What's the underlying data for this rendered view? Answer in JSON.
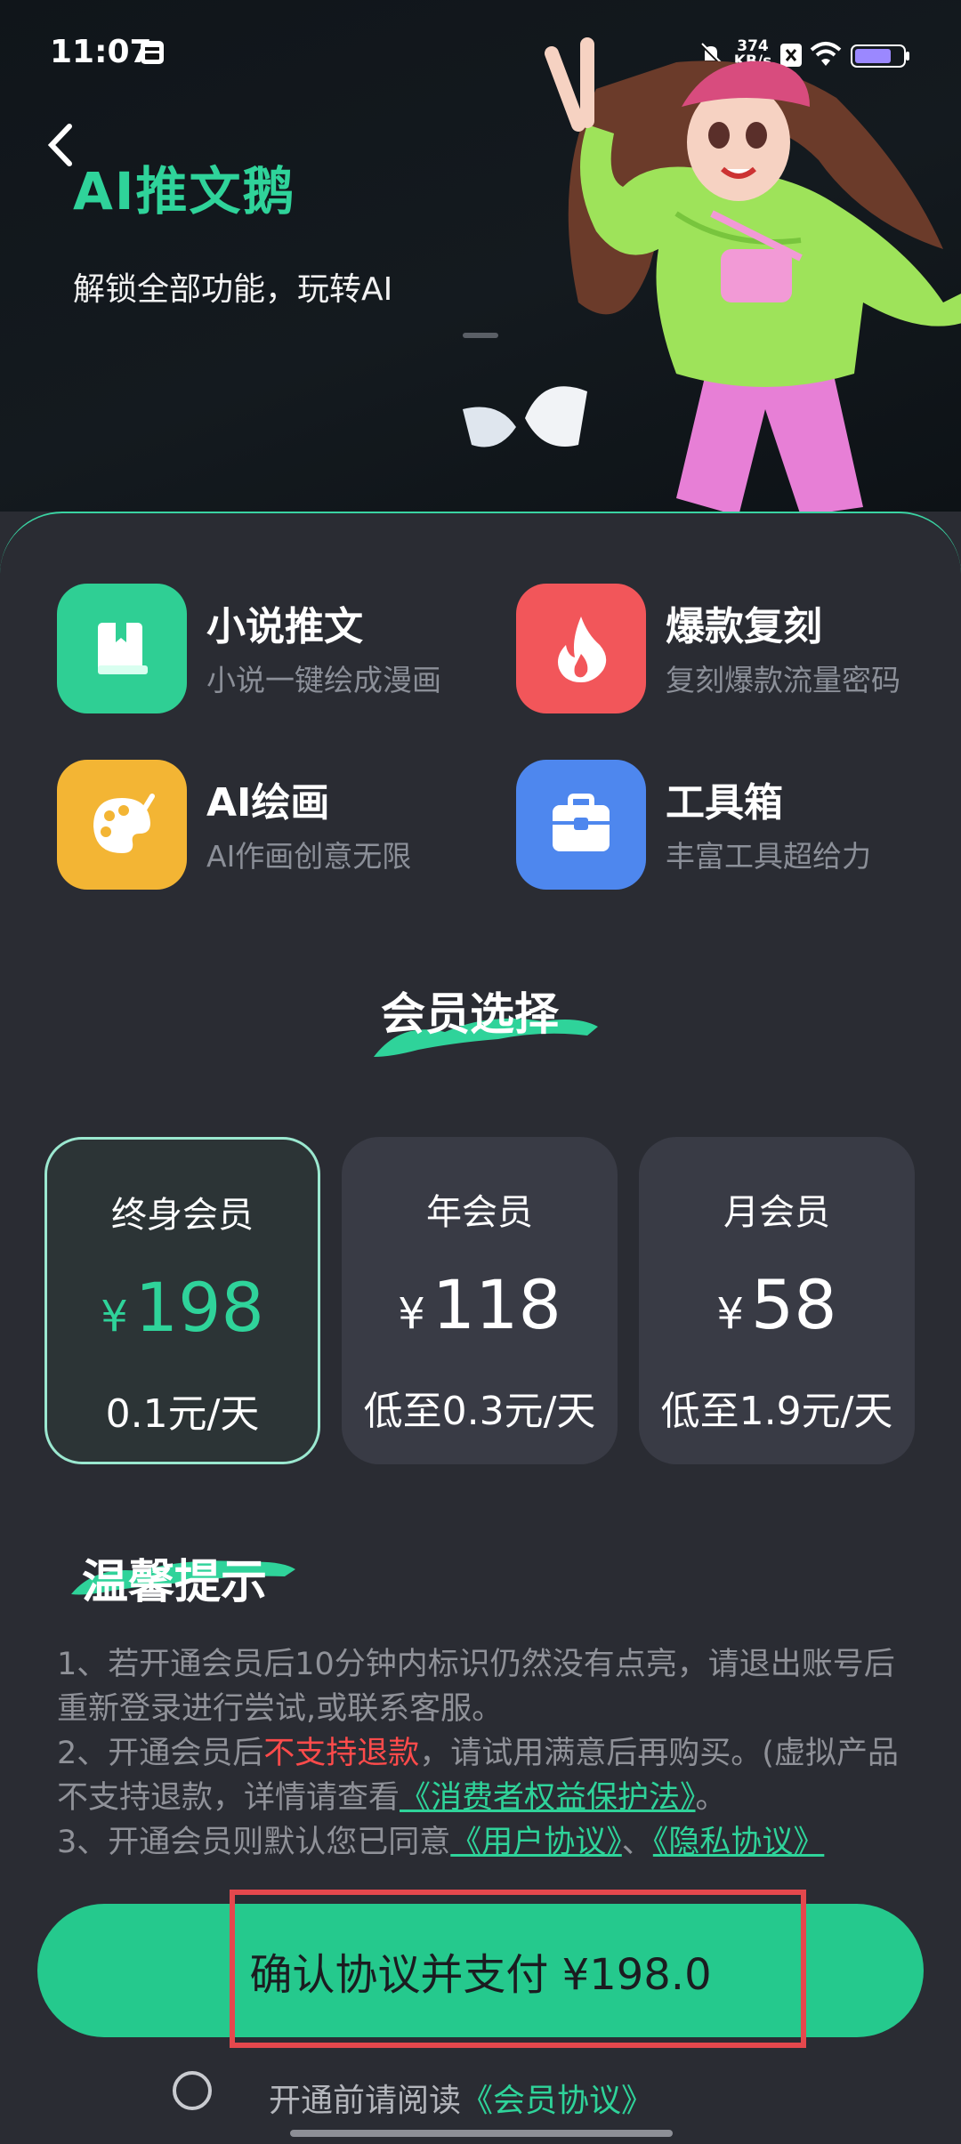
{
  "status_bar": {
    "time": "11:07",
    "net_speed_value": "374",
    "net_speed_unit": "KB/s"
  },
  "hero": {
    "brand": "AI推文鹅",
    "slogan": "解锁全部功能，玩转AI"
  },
  "features": [
    {
      "title": "小说推文",
      "subtitle": "小说一键绘成漫画",
      "icon": "book-icon",
      "color": "#2fcf94"
    },
    {
      "title": "爆款复刻",
      "subtitle": "复刻爆款流量密码",
      "icon": "flame-icon",
      "color": "#f2565a"
    },
    {
      "title": "AI绘画",
      "subtitle": "AI作画创意无限",
      "icon": "palette-icon",
      "color": "#f3b534"
    },
    {
      "title": "工具箱",
      "subtitle": "丰富工具超给力",
      "icon": "toolbox-icon",
      "color": "#4e87ee"
    }
  ],
  "membership": {
    "title": "会员选择",
    "plans": [
      {
        "name": "终身会员",
        "currency": "¥",
        "price": "198",
        "daily": "0.1元/天",
        "selected": true
      },
      {
        "name": "年会员",
        "currency": "¥",
        "price": "118",
        "daily": "低至0.3元/天",
        "selected": false
      },
      {
        "name": "月会员",
        "currency": "¥",
        "price": "58",
        "daily": "低至1.9元/天",
        "selected": false
      }
    ]
  },
  "tips": {
    "title": "温馨提示",
    "line1": "1、若开通会员后10分钟内标识仍然没有点亮，请退出账号后重新登录进行尝试,或联系客服。",
    "line2_a": "2、开通会员后",
    "line2_red": "不支持退款",
    "line2_b": "，请试用满意后再购买。(虚拟产品不支持退款，详情请查看",
    "line2_link": "《消费者权益保护法》",
    "line2_c": "。",
    "line3_a": "3、开通会员则默认您已同意",
    "line3_link1": "《用户协议》",
    "line3_sep": "、",
    "line3_link2": "《隐私协议》"
  },
  "pay_button": "确认协议并支付 ¥198.0",
  "agreement": {
    "text": "开通前请阅读",
    "link": "《会员协议》"
  },
  "colors": {
    "accent": "#2fd39a",
    "background": "#2a2c33",
    "card": "#393b45",
    "highlight_box": "#e5484d"
  }
}
